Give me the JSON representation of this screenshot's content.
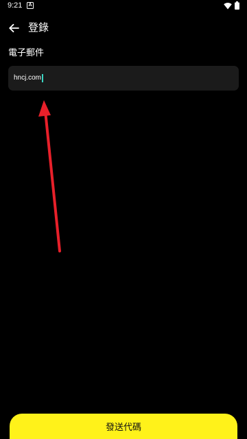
{
  "status_bar": {
    "time": "9:21",
    "notification_icon": "A",
    "icons": [
      "wifi-icon",
      "battery-icon"
    ]
  },
  "header": {
    "back_icon": "arrow-left-icon",
    "title": "登錄"
  },
  "form": {
    "email_label": "電子郵件",
    "email_value": "hncj.com"
  },
  "footer": {
    "send_code_label": "發送代碼"
  },
  "colors": {
    "background": "#000000",
    "input_background": "#1b1b1b",
    "accent_button": "#fff21a",
    "cursor": "#39d6c3",
    "annotation_arrow": "#e8202a"
  }
}
